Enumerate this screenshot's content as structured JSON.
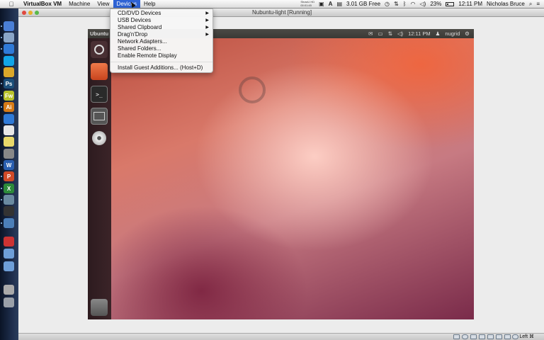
{
  "menubar": {
    "app_name": "VirtualBox VM",
    "items": [
      "Machine",
      "View",
      "Devices",
      "Help"
    ],
    "active_item": "Devices",
    "status_mini": [
      "ShowU HD",
      "00:01:45"
    ],
    "disk_free": "3.01 GB Free",
    "battery_percent": "23%",
    "time": "12:11 PM",
    "user": "Nicholas Bruce"
  },
  "window": {
    "title": "Nubuntu-light [Running]"
  },
  "guest": {
    "panel_title": "Ubuntu",
    "time": "12:11 PM",
    "user": "nugrid"
  },
  "devices_menu": {
    "items": [
      {
        "label": "CD/DVD Devices",
        "submenu": true
      },
      {
        "label": "USB Devices",
        "submenu": true
      },
      {
        "label": "Shared Clipboard",
        "submenu": true
      },
      {
        "label": "Drag'n'Drop",
        "submenu": true
      },
      {
        "label": "Network Adapters...",
        "submenu": false
      },
      {
        "label": "Shared Folders...",
        "submenu": false
      },
      {
        "label": "Enable Remote Display",
        "submenu": false
      }
    ],
    "guest_additions": "Install Guest Additions... (Host+D)"
  },
  "statusbar": {
    "host_key": "Left ⌘"
  },
  "icons": {
    "apple": "apple-icon",
    "submenu": "chevron-right-icon",
    "dock": [
      "finder-icon",
      "compass-icon",
      "globe-icon",
      "skype-icon",
      "chrome-icon",
      "photoshop-icon",
      "fireworks-icon",
      "illustrator-icon",
      "globe-icon",
      "document-icon",
      "notes-icon",
      "photo-icon",
      "word-icon",
      "powerpoint-icon",
      "excel-icon",
      "preview-icon",
      "terminal-icon",
      "virtualbox-icon",
      "screenflow-icon",
      "folder-icon",
      "folder-icon",
      "drive-icon",
      "trash-icon"
    ]
  },
  "colors": {
    "menu_highlight": "#2e62d4",
    "ubuntu_panel": "#3c3b37"
  }
}
